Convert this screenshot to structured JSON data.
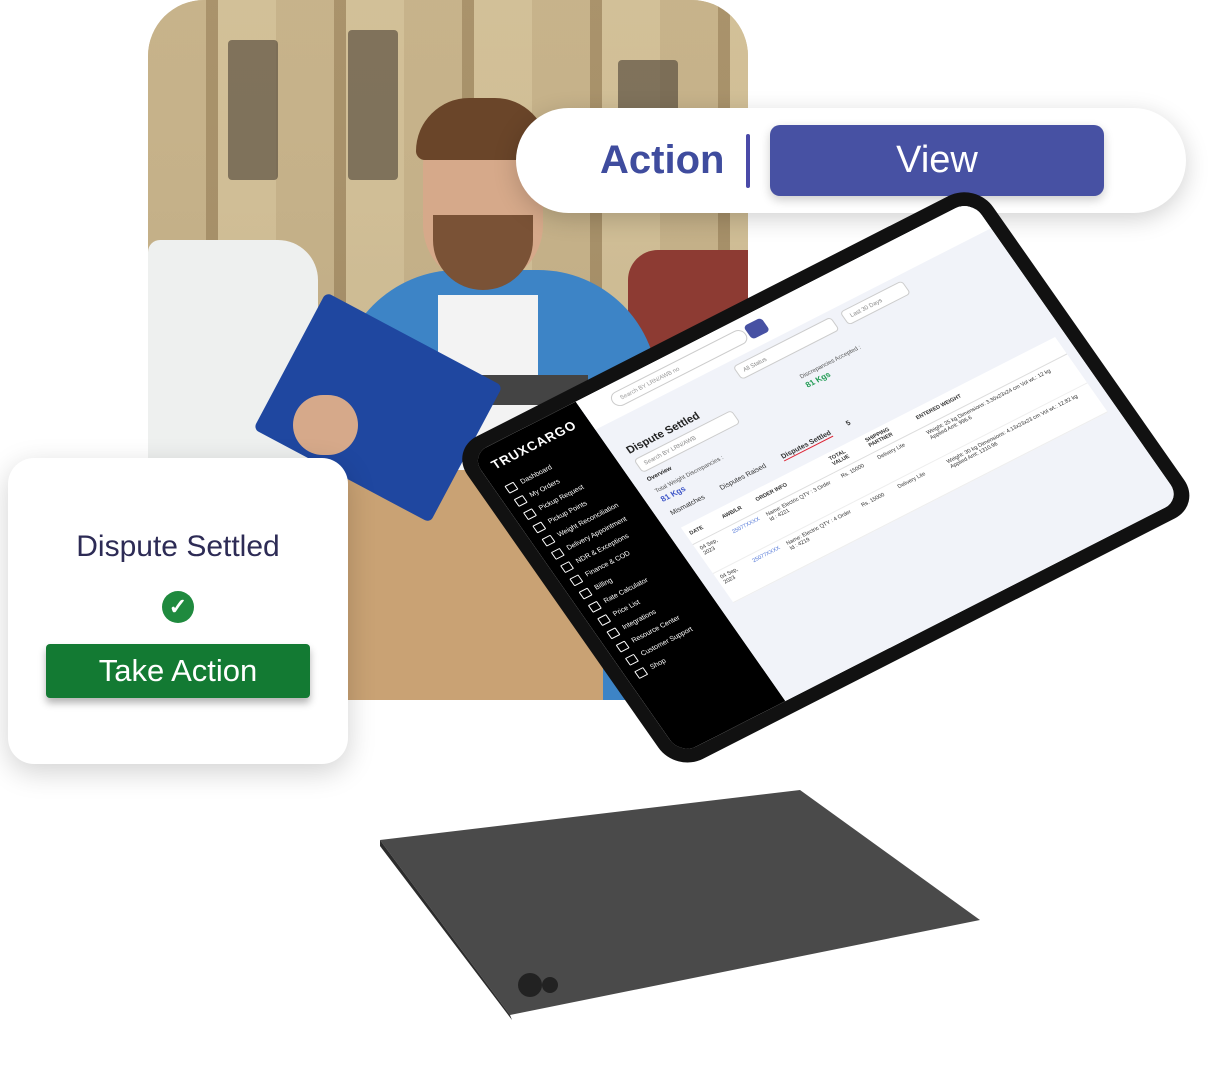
{
  "action_pill": {
    "label": "Action",
    "button": "View"
  },
  "dispute_card": {
    "title": "Dispute Settled",
    "button": "Take Action"
  },
  "tablet": {
    "brand": "TRUXCARGO",
    "nav": [
      "Dashboard",
      "My Orders",
      "Pickup Request",
      "Pickup Points",
      "Weight Reconciliation",
      "Delivery Appointment",
      "NDR & Exceptions",
      "Finance & COD",
      "Billing",
      "Rate Calculator",
      "Price List",
      "Integrations",
      "Resource Center",
      "Customer Support",
      "Shop"
    ],
    "search_placeholder": "Search BY LRN/AWB no",
    "filter_days": "Last 30 Days",
    "filter_status": "All Status",
    "page_title": "Dispute Settled",
    "page_search_placeholder": "Search BY LRN/AWB",
    "overview": "Overview",
    "total_label": "Total Weight Discrepancies :",
    "total_value": "81 Kgs",
    "accepted_label": "Discrepancies Accepted :",
    "accepted_value": "81 Kgs",
    "tabs": [
      "Mismatches",
      "Disputes Raised",
      "Disputes Settled"
    ],
    "settled_count": "5",
    "columns": [
      "DATE",
      "AWB/LR",
      "ORDER INFO",
      "TOTAL VALUE",
      "SHIPPING PARTNER",
      "ENTERED WEIGHT"
    ],
    "rows": [
      {
        "date": "04 Sep, 2023",
        "awb": "25077XXXX",
        "order": "Name: Electric QTY : 3 Order Id : 4221",
        "value": "Rs. 15000",
        "partner": "Delivery Lite",
        "weight": "Weight: 25 kg Dimensions: 3.30x23x24 cm Vol wt.: 12 kg Applied Amt: 996.6"
      },
      {
        "date": "04 Sep, 2023",
        "awb": "25077XXXX",
        "order": "Name: Electric QTY : 4 Order Id : 4219",
        "value": "Rs. 15000",
        "partner": "Delivery Lite",
        "weight": "Weight: 30 kg Dimensions: 4.13x23x23 cm Vol wt.: 12.82 kg Applied Amt: 1310.96"
      }
    ]
  }
}
